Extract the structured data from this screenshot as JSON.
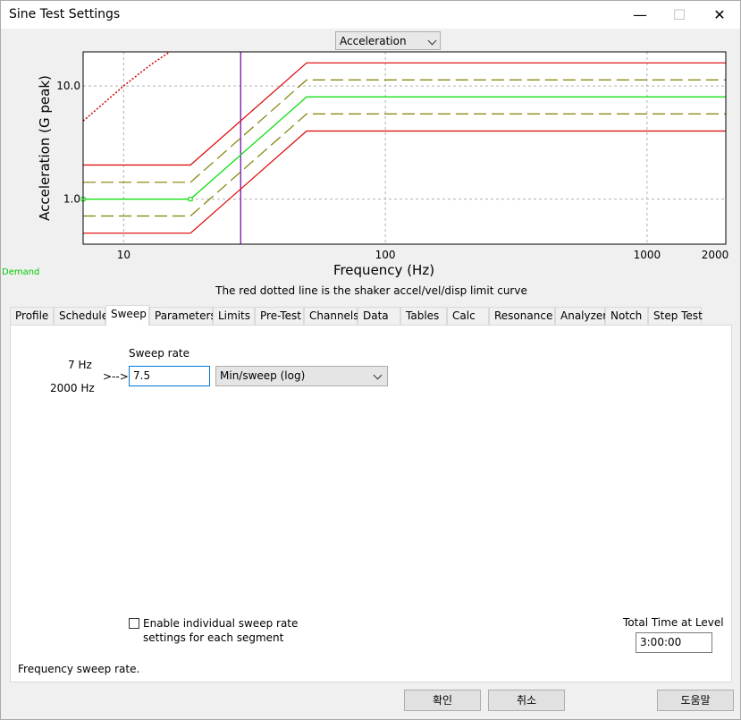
{
  "window": {
    "title": "Sine Test Settings",
    "minimize": "—",
    "maximize": "☐",
    "close": "✕"
  },
  "plot_selector": {
    "value": "Acceleration"
  },
  "chart_data": {
    "type": "line",
    "xlabel": "Frequency (Hz)",
    "ylabel": "Acceleration (G peak)",
    "x_scale": "log",
    "y_scale": "log",
    "xlim": [
      7,
      2000
    ],
    "ylim": [
      0.4,
      20
    ],
    "x_ticks": [
      10,
      100,
      1000,
      2000
    ],
    "x_tick_labels": [
      "10",
      "100",
      "1000",
      "2000"
    ],
    "y_ticks": [
      1.0,
      10.0
    ],
    "y_tick_labels": [
      "1.0",
      "10.0"
    ],
    "grid": true,
    "cursor_x": 28,
    "series": [
      {
        "role": "demand",
        "color": "#00dd00",
        "style": "solid",
        "x": [
          7,
          18,
          50,
          2000
        ],
        "y": [
          1.0,
          1.0,
          8.0,
          8.0
        ]
      },
      {
        "role": "warning-upper",
        "color": "#808000",
        "style": "dashed",
        "x": [
          7,
          18,
          50,
          2000
        ],
        "y": [
          1.41,
          1.41,
          11.3,
          11.3
        ]
      },
      {
        "role": "warning-lower",
        "color": "#808000",
        "style": "dashed",
        "x": [
          7,
          18,
          50,
          2000
        ],
        "y": [
          0.71,
          0.71,
          5.66,
          5.66
        ]
      },
      {
        "role": "abort-upper",
        "color": "#dd0000",
        "style": "solid",
        "x": [
          7,
          18,
          50,
          2000
        ],
        "y": [
          2.0,
          2.0,
          16.0,
          16.0
        ]
      },
      {
        "role": "abort-lower",
        "color": "#dd0000",
        "style": "solid",
        "x": [
          7,
          18,
          50,
          2000
        ],
        "y": [
          0.5,
          0.5,
          4.0,
          4.0
        ]
      },
      {
        "role": "shaker-limit",
        "color": "#cc0000",
        "style": "dotted",
        "x": [
          7,
          10,
          12.5,
          15
        ],
        "y": [
          4.9,
          10.0,
          15.0,
          20.0
        ]
      }
    ],
    "legend_label": "Demand"
  },
  "caption": "The red dotted line is the shaker accel/vel/disp limit curve",
  "tabs": [
    "Profile",
    "Schedule",
    "Sweep",
    "Parameters",
    "Limits",
    "Pre-Test",
    "Channels",
    "Data",
    "Tables",
    "Calc",
    "Resonance",
    "Analyzer",
    "Notch",
    "Step Test"
  ],
  "active_tab": "Sweep",
  "sweep": {
    "heading": "Sweep rate",
    "freq_start": "7 Hz",
    "freq_end": "2000 Hz",
    "arrow": ">-->",
    "rate_value": "7.5",
    "rate_unit": "Min/sweep (log)",
    "checkbox_line1": "Enable individual sweep rate",
    "checkbox_line2": "settings for each segment",
    "checkbox_checked": false,
    "total_time_label": "Total Time at Level",
    "total_time_value": "3:00:00",
    "status": "Frequency sweep rate."
  },
  "buttons": {
    "ok": "확인",
    "cancel": "취소",
    "help": "도움말"
  }
}
